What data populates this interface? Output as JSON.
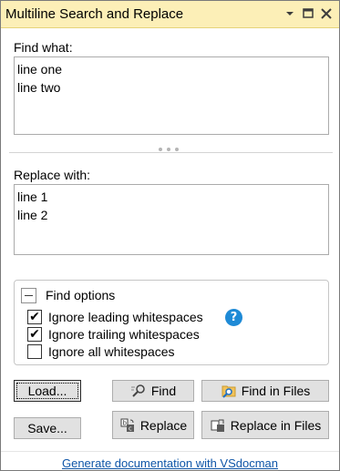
{
  "window": {
    "title": "Multiline Search and Replace",
    "icons": [
      "dropdown-arrow-icon",
      "maximize-icon",
      "close-icon"
    ]
  },
  "find": {
    "label": "Find what:",
    "value": "line one\nline two"
  },
  "replace": {
    "label": "Replace with:",
    "value": "line 1\nline 2"
  },
  "options": {
    "title": "Find options",
    "items": [
      {
        "label": "Ignore leading whitespaces",
        "checked": true
      },
      {
        "label": "Ignore trailing whitespaces",
        "checked": true
      },
      {
        "label": "Ignore all whitespaces",
        "checked": false
      }
    ],
    "help_icon": "help-icon"
  },
  "buttons": {
    "load": "Load...",
    "save": "Save...",
    "find": "Find",
    "find_in_files": "Find in Files",
    "replace": "Replace",
    "replace_in_files": "Replace in Files"
  },
  "footer": {
    "link": "Generate documentation with VSdocman"
  },
  "colors": {
    "titlebar": "#fcefb7",
    "link": "#0f56a8",
    "help": "#1e8ad6"
  }
}
